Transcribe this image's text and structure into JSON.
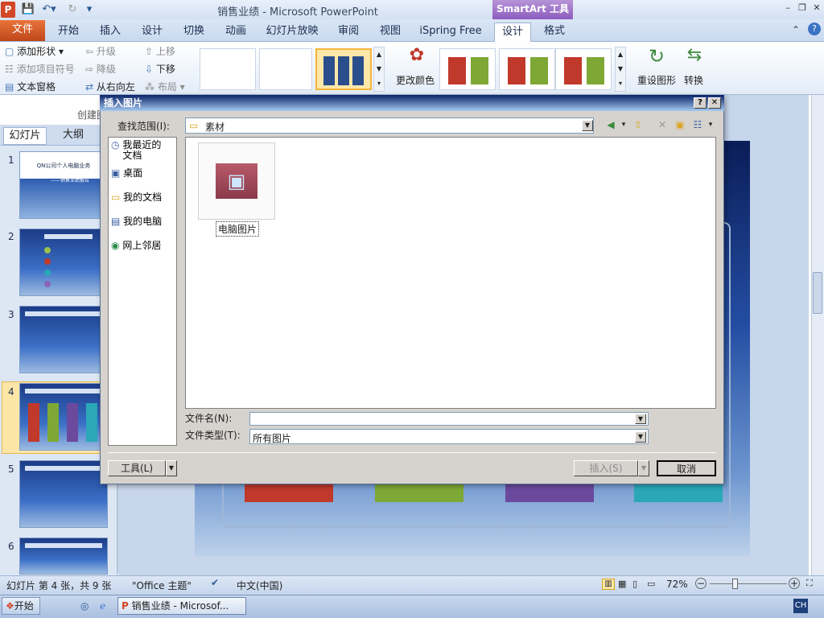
{
  "window": {
    "title": "销售业绩 - Microsoft PowerPoint",
    "context_tab": "SmartArt 工具"
  },
  "ribbon_tabs": [
    "开始",
    "插入",
    "设计",
    "切换",
    "动画",
    "幻灯片放映",
    "审阅",
    "视图",
    "iSpring Free",
    "设计",
    "格式"
  ],
  "file_tab": "文件",
  "ribbon": {
    "create_graphic": {
      "add_shape": "添加形状",
      "add_bullet": "添加项目符号",
      "text_pane": "文本窗格",
      "promote": "升级",
      "demote": "降级",
      "right_to_left": "从右向左",
      "move_up": "上移",
      "move_down": "下移",
      "layout": "布局",
      "group_label": "创建图"
    },
    "change_colors": "更改颜色",
    "reset_graphic": "重设图形",
    "convert": "转换"
  },
  "sidebar": {
    "tab_slides": "幻灯片",
    "tab_outline": "大纲",
    "slide_numbers": [
      "1",
      "2",
      "3",
      "4",
      "5",
      "6"
    ],
    "slide1_title": "QN公司个人电脑业务",
    "slide1_sub": "——销售业绩报告"
  },
  "dialog": {
    "title": "插入图片",
    "look_in_label": "查找范围(I):",
    "look_in_value": "素材",
    "places": [
      {
        "label": "我最近的文档",
        "icon": "recent-docs-icon"
      },
      {
        "label": "桌面",
        "icon": "desktop-icon"
      },
      {
        "label": "我的文档",
        "icon": "my-documents-icon"
      },
      {
        "label": "我的电脑",
        "icon": "my-computer-icon"
      },
      {
        "label": "网上邻居",
        "icon": "network-icon"
      }
    ],
    "file_item": "电脑图片",
    "filename_label": "文件名(N):",
    "filename_value": "",
    "filetype_label": "文件类型(T):",
    "filetype_value": "所有图片",
    "tools_label": "工具(L)",
    "insert_label": "插入(S)",
    "cancel_label": "取消",
    "help": "?",
    "close": "✕"
  },
  "status": {
    "slide_info": "幻灯片 第 4 张，共 9 张",
    "theme": "\"Office 主题\"",
    "language": "中文(中国)",
    "zoom": "72%"
  },
  "taskbar": {
    "start": "开始",
    "task": "销售业绩 - Microsof...",
    "ime": "CH"
  },
  "colors": {
    "accent_red": "#c0392b",
    "accent_green": "#7ea836",
    "accent_purple": "#6b4a9e",
    "accent_teal": "#2aa8b8"
  }
}
